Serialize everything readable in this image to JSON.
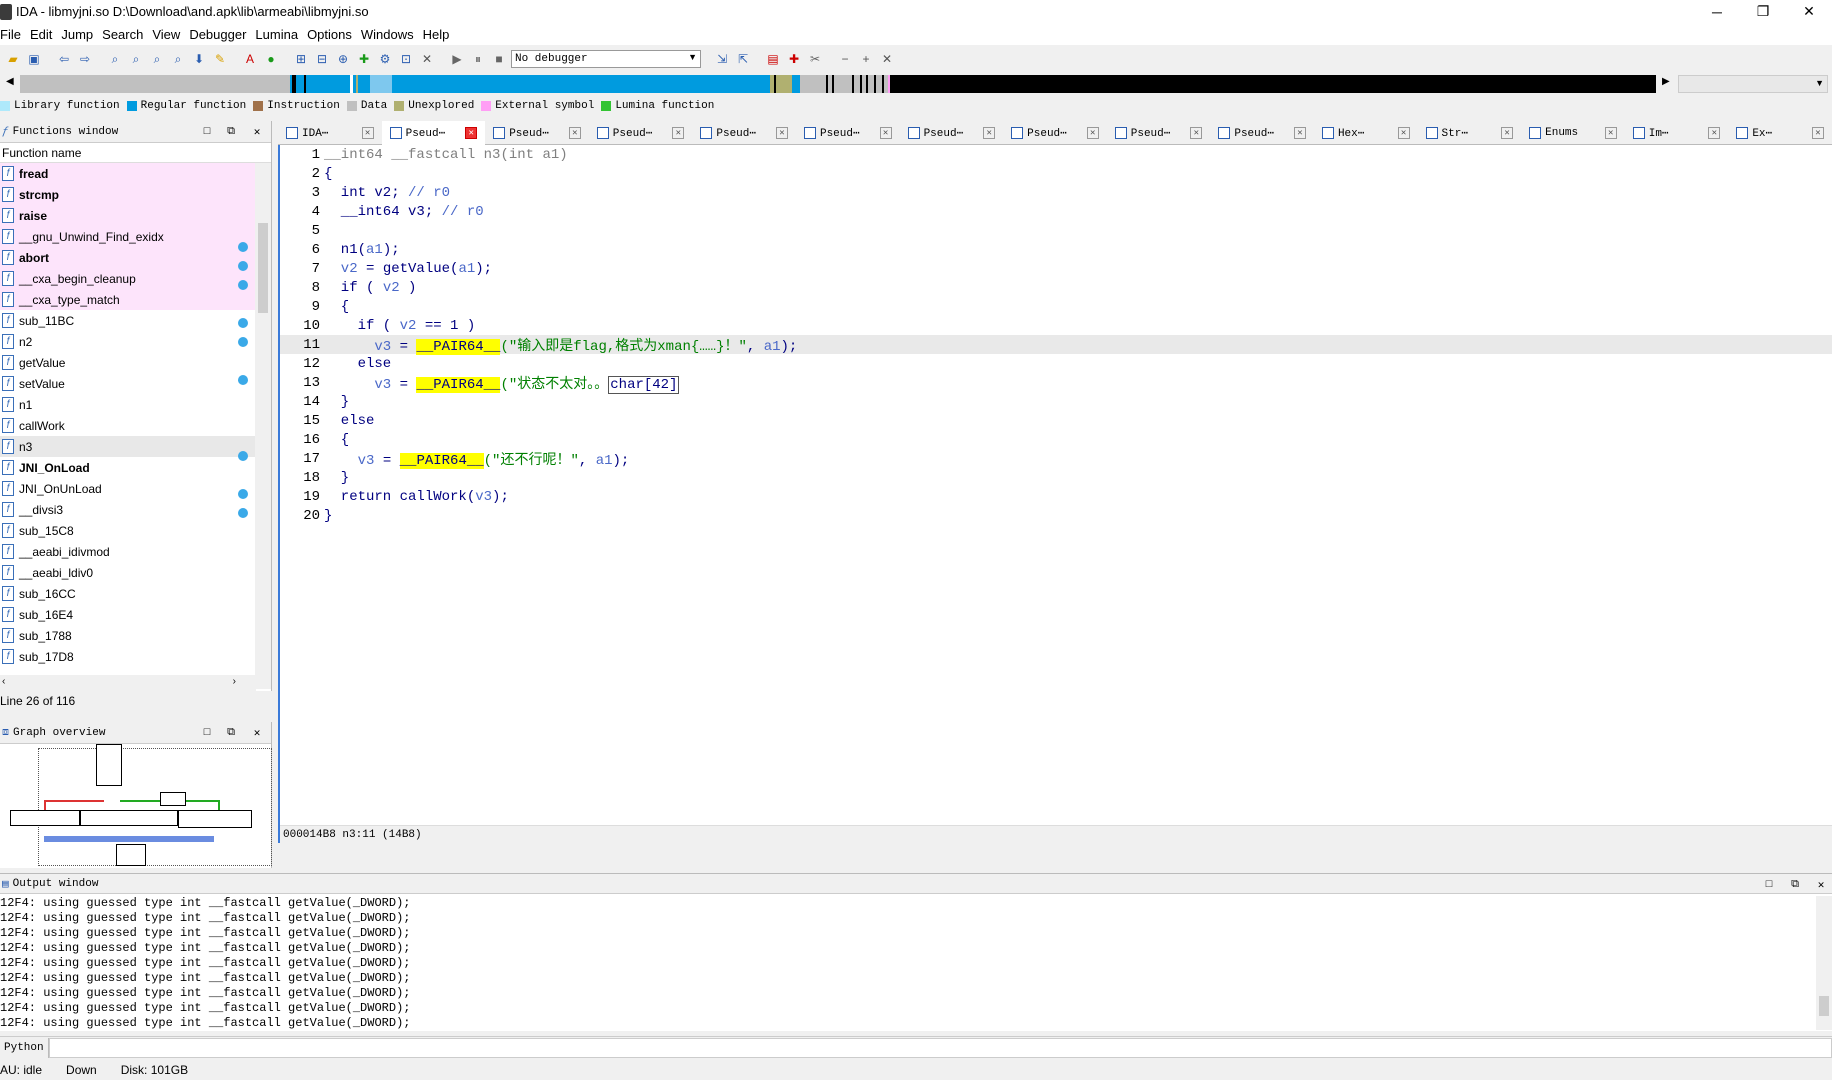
{
  "window": {
    "title": "IDA - libmyjni.so D:\\Download\\and.apk\\lib\\armeabi\\libmyjni.so",
    "minimize": "─",
    "maximize": "❐",
    "close": "✕"
  },
  "menu": [
    "File",
    "Edit",
    "Jump",
    "Search",
    "View",
    "Debugger",
    "Lumina",
    "Options",
    "Windows",
    "Help"
  ],
  "toolbar": {
    "debugger_select": "No debugger"
  },
  "legend": [
    {
      "label": "Library function",
      "color": "#aee9fb"
    },
    {
      "label": "Regular function",
      "color": "#009bdf"
    },
    {
      "label": "Instruction",
      "color": "#a0714a"
    },
    {
      "label": "Data",
      "color": "#c0c0c0"
    },
    {
      "label": "Unexplored",
      "color": "#b0b070"
    },
    {
      "label": "External symbol",
      "color": "#ff9ef5"
    },
    {
      "label": "Lumina function",
      "color": "#33c433"
    }
  ],
  "functions_window": {
    "title": "Functions window",
    "column": "Function name",
    "items": [
      {
        "name": "fread",
        "lib": true,
        "bold": true
      },
      {
        "name": "strcmp",
        "lib": true,
        "bold": true
      },
      {
        "name": "raise",
        "lib": true,
        "bold": true
      },
      {
        "name": "__gnu_Unwind_Find_exidx",
        "lib": true,
        "bold": false
      },
      {
        "name": "abort",
        "lib": true,
        "bold": true
      },
      {
        "name": "__cxa_begin_cleanup",
        "lib": true,
        "bold": false
      },
      {
        "name": "__cxa_type_match",
        "lib": true,
        "bold": false
      },
      {
        "name": "sub_11BC",
        "lib": false,
        "bold": false
      },
      {
        "name": "n2",
        "lib": false,
        "bold": false
      },
      {
        "name": "getValue",
        "lib": false,
        "bold": false
      },
      {
        "name": "setValue",
        "lib": false,
        "bold": false
      },
      {
        "name": "n1",
        "lib": false,
        "bold": false
      },
      {
        "name": "callWork",
        "lib": false,
        "bold": false
      },
      {
        "name": "n3",
        "lib": false,
        "bold": false,
        "selected": true
      },
      {
        "name": "JNI_OnLoad",
        "lib": false,
        "bold": true
      },
      {
        "name": "JNI_OnUnLoad",
        "lib": false,
        "bold": false
      },
      {
        "name": "__divsi3",
        "lib": false,
        "bold": false
      },
      {
        "name": "sub_15C8",
        "lib": false,
        "bold": false
      },
      {
        "name": "__aeabi_idivmod",
        "lib": false,
        "bold": false
      },
      {
        "name": "__aeabi_ldiv0",
        "lib": false,
        "bold": false
      },
      {
        "name": "sub_16CC",
        "lib": false,
        "bold": false
      },
      {
        "name": "sub_16E4",
        "lib": false,
        "bold": false
      },
      {
        "name": "sub_1788",
        "lib": false,
        "bold": false
      },
      {
        "name": "sub_17D8",
        "lib": false,
        "bold": false
      }
    ],
    "line_status": "Line 26 of 116"
  },
  "graph_overview": {
    "title": "Graph overview"
  },
  "tabs": [
    {
      "label": "IDA⋯",
      "active": false
    },
    {
      "label": "Pseud⋯",
      "active": true
    },
    {
      "label": "Pseud⋯",
      "active": false
    },
    {
      "label": "Pseud⋯",
      "active": false
    },
    {
      "label": "Pseud⋯",
      "active": false
    },
    {
      "label": "Pseud⋯",
      "active": false
    },
    {
      "label": "Pseud⋯",
      "active": false
    },
    {
      "label": "Pseud⋯",
      "active": false
    },
    {
      "label": "Pseud⋯",
      "active": false
    },
    {
      "label": "Pseud⋯",
      "active": false
    },
    {
      "label": "Hex⋯",
      "active": false
    },
    {
      "label": "Str⋯",
      "active": false
    },
    {
      "label": "Enums",
      "active": false
    },
    {
      "label": "Im⋯",
      "active": false
    },
    {
      "label": "Ex⋯",
      "active": false
    }
  ],
  "code": {
    "lines": [
      {
        "n": "1",
        "dot": false
      },
      {
        "n": "2",
        "dot": false
      },
      {
        "n": "3",
        "dot": false
      },
      {
        "n": "4",
        "dot": false
      },
      {
        "n": "5",
        "dot": false
      },
      {
        "n": "6",
        "dot": true
      },
      {
        "n": "7",
        "dot": true
      },
      {
        "n": "8",
        "dot": true
      },
      {
        "n": "9",
        "dot": false
      },
      {
        "n": "10",
        "dot": true
      },
      {
        "n": "11",
        "dot": true
      },
      {
        "n": "12",
        "dot": false
      },
      {
        "n": "13",
        "dot": true
      },
      {
        "n": "14",
        "dot": false
      },
      {
        "n": "15",
        "dot": false
      },
      {
        "n": "16",
        "dot": false
      },
      {
        "n": "17",
        "dot": true
      },
      {
        "n": "18",
        "dot": false
      },
      {
        "n": "19",
        "dot": true
      },
      {
        "n": "20",
        "dot": true
      }
    ],
    "t": {
      "l1_type": "__int64 __fastcall ",
      "l1_name": "n3",
      "l1_args": "(int a1)",
      "l2": "{",
      "l3_decl": "  int v2; ",
      "l3_cmt": "// r0",
      "l4_decl": "  __int64 v3; ",
      "l4_cmt": "// r0",
      "l6_fn": "  n1(",
      "l6_arg": "a1",
      "l6_end": ");",
      "l7_var": "  v2",
      "l7_mid": " = getValue(",
      "l7_arg": "a1",
      "l7_end": ");",
      "l8_a": "  if ( ",
      "l8_var": "v2",
      "l8_b": " )",
      "l9": "  {",
      "l10_a": "    if ( ",
      "l10_var": "v2",
      "l10_b": " == 1 )",
      "l11_var": "      v3",
      "l11_eq": " = ",
      "l11_macro": "__PAIR64__",
      "l11_str": "(\"输入即是flag,格式为xman{……}！\"",
      "l11_sep": ", ",
      "l11_arg": "a1",
      "l11_end": ");",
      "l12": "    else",
      "l13_var": "      v3",
      "l13_eq": " = ",
      "l13_macro": "__PAIR64__",
      "l13_str": "(\"状态不太对。。",
      "l13_hint": "char[42]",
      "l14": "  }",
      "l15": "  else",
      "l16": "  {",
      "l17_var": "    v3",
      "l17_eq": " = ",
      "l17_macro": "__PAIR64__",
      "l17_str": "(\"还不行呢！\"",
      "l17_sep": ", ",
      "l17_arg": "a1",
      "l17_end": ");",
      "l18": "  }",
      "l19_a": "  return callWork(",
      "l19_var": "v3",
      "l19_end": ");",
      "l20": "}"
    },
    "status": "000014B8 n3:11 (14B8)"
  },
  "output": {
    "title": "Output window",
    "lines": [
      "12F4: using guessed type int __fastcall getValue(_DWORD);",
      "12F4: using guessed type int __fastcall getValue(_DWORD);",
      "12F4: using guessed type int __fastcall getValue(_DWORD);",
      "12F4: using guessed type int __fastcall getValue(_DWORD);",
      "12F4: using guessed type int __fastcall getValue(_DWORD);",
      "12F4: using guessed type int __fastcall getValue(_DWORD);",
      "12F4: using guessed type int __fastcall getValue(_DWORD);",
      "12F4: using guessed type int __fastcall getValue(_DWORD);",
      "12F4: using guessed type int __fastcall getValue(_DWORD);"
    ]
  },
  "python": {
    "label": "Python"
  },
  "status": {
    "state": "AU:  idle",
    "dir": "Down",
    "disk": "Disk: 101GB"
  }
}
